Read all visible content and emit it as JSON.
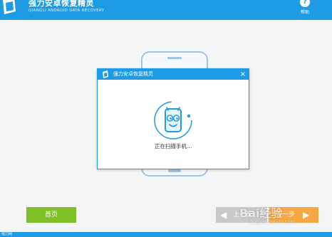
{
  "app": {
    "title": "强力安卓恢复精灵",
    "subtitle": "QIANGLI ANDROID DATA RECOVERY",
    "help_label": "帮助",
    "help_icon": "question-icon"
  },
  "dialog": {
    "title": "强力安卓恢复精灵",
    "close_label": "×",
    "status_text": "正在扫描手机..."
  },
  "nav": {
    "home_label": "首页",
    "prev_label": "上一步",
    "next_label": "下一步"
  },
  "watermark": {
    "text": "Bai经验",
    "sub": "jingyan.baidu.com"
  },
  "statusbar": {
    "text": "强力网"
  },
  "colors": {
    "accent": "#1e9be5",
    "home_button": "#7fbf28",
    "next_button": "#f7a845",
    "prev_button": "#c9c9c9"
  }
}
